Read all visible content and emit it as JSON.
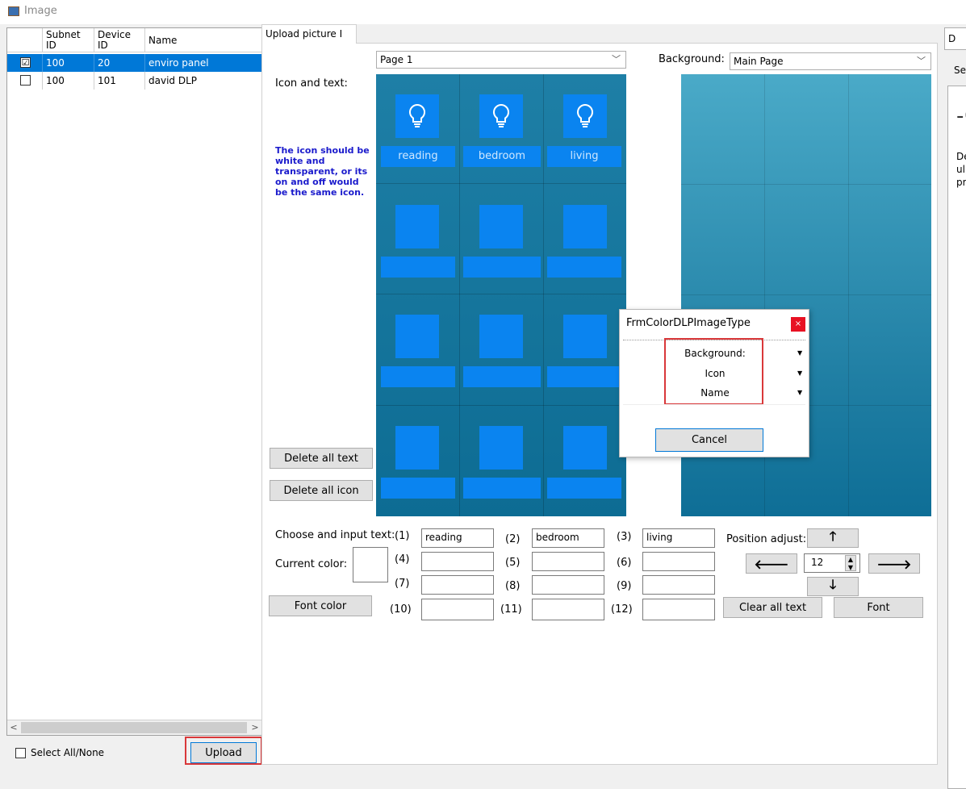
{
  "window": {
    "title": "Image"
  },
  "device_table": {
    "headers": {
      "subnet_id": "Subnet ID",
      "device_id": "Device ID",
      "name": "Name"
    },
    "rows": [
      {
        "checked": true,
        "check": "☑",
        "subnet": "100",
        "device": "20",
        "name": "enviro panel",
        "selected": true
      },
      {
        "checked": false,
        "check": "",
        "subnet": "100",
        "device": "101",
        "name": "david DLP",
        "selected": false
      }
    ]
  },
  "footer": {
    "select_all_label": "Select All/None",
    "upload_label": "Upload"
  },
  "tab": {
    "label": "Upload picture I"
  },
  "page_select": {
    "value": "Page 1"
  },
  "background": {
    "label": "Background:",
    "value": "Main Page"
  },
  "icon_text_label": "Icon and text:",
  "hint": "The icon should be white and transparent, or its on and off would be the same icon.",
  "icon_grid": {
    "row1_labels": [
      "reading",
      "bedroom",
      "living"
    ]
  },
  "buttons": {
    "delete_all_text": "Delete all text",
    "delete_all_icon": "Delete all icon",
    "font_color": "Font color",
    "clear_all_text": "Clear all text",
    "font": "Font"
  },
  "text_inputs": {
    "choose_label": "Choose and input text:",
    "current_color_label": "Current color:",
    "fields": [
      {
        "num": "(1)",
        "value": "reading"
      },
      {
        "num": "(2)",
        "value": "bedroom"
      },
      {
        "num": "(3)",
        "value": "living"
      },
      {
        "num": "(4)",
        "value": ""
      },
      {
        "num": "(5)",
        "value": ""
      },
      {
        "num": "(6)",
        "value": ""
      },
      {
        "num": "(7)",
        "value": ""
      },
      {
        "num": "(8)",
        "value": ""
      },
      {
        "num": "(9)",
        "value": ""
      },
      {
        "num": "(10)",
        "value": ""
      },
      {
        "num": "(11)",
        "value": ""
      },
      {
        "num": "(12)",
        "value": ""
      }
    ]
  },
  "position_adjust": {
    "label": "Position adjust:",
    "step": "12",
    "up": "🡑",
    "left": "🡐",
    "right": "🡒",
    "down": "🡓"
  },
  "dialog": {
    "title": "FrmColorDLPImageType",
    "close": "×",
    "items": [
      "Background:",
      "Icon",
      "Name"
    ],
    "cancel": "Cancel"
  },
  "right_panel": {
    "tab_fragment": "D",
    "se_fragment": "Se",
    "text_fragments": [
      "De",
      "ul",
      "pr"
    ]
  },
  "colors": {
    "selection": "#0078d7",
    "tile": "#0a84f0",
    "grid_bg": "#0c6e97",
    "highlight": "#d9383a",
    "hint": "#1a1acc"
  }
}
